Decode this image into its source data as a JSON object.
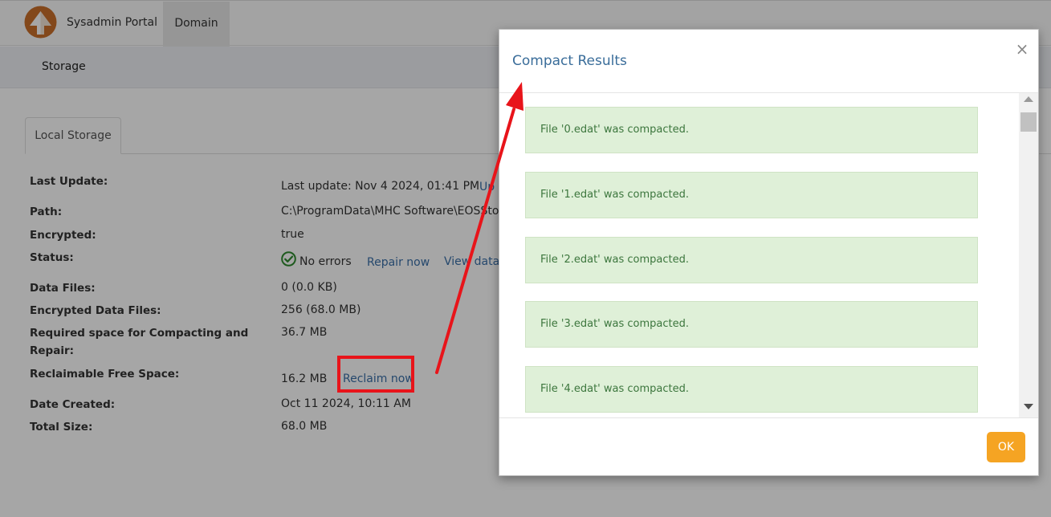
{
  "header": {
    "brand": "Sysadmin Portal",
    "nav_tab": "Domain"
  },
  "subnav": {
    "item": "Storage"
  },
  "tab": {
    "label": "Local Storage"
  },
  "details": {
    "last_update_label": "Last Update:",
    "last_update_value": "Last update: Nov 4 2024, 01:41 PM",
    "last_update_link": "Up",
    "path_label": "Path:",
    "path_value": "C:\\ProgramData\\MHC Software\\EOSStorag",
    "encrypted_label": "Encrypted:",
    "encrypted_value": "true",
    "status_label": "Status:",
    "status_value": "No errors",
    "repair_link": "Repair now",
    "view_link": "View data",
    "data_files_label": "Data Files:",
    "data_files_value": "0 (0.0 KB)",
    "enc_files_label": "Encrypted Data Files:",
    "enc_files_value": "256 (68.0 MB)",
    "req_space_label_1": "Required space for Compacting and",
    "req_space_label_2": "Repair:",
    "req_space_value": "36.7 MB",
    "reclaim_label": "Reclaimable Free Space:",
    "reclaim_value": "16.2 MB",
    "reclaim_link": "Reclaim now",
    "created_label": "Date Created:",
    "created_value": "Oct 11 2024, 10:11 AM",
    "total_label": "Total Size:",
    "total_value": "68.0 MB"
  },
  "modal": {
    "title": "Compact Results",
    "close_glyph": "×",
    "results": [
      "File '0.edat' was compacted.",
      "File '1.edat' was compacted.",
      "File '2.edat' was compacted.",
      "File '3.edat' was compacted.",
      "File '4.edat' was compacted."
    ],
    "ok_label": "OK"
  },
  "colors": {
    "accent": "#f5a423",
    "link": "#3a6fa8",
    "success_bg": "#dff0d8",
    "success_text": "#3c763d",
    "annotation": "#e8141a"
  },
  "icons": {
    "logo": "arrow-up-logo-icon",
    "status": "check-circle-icon",
    "close": "close-icon"
  }
}
